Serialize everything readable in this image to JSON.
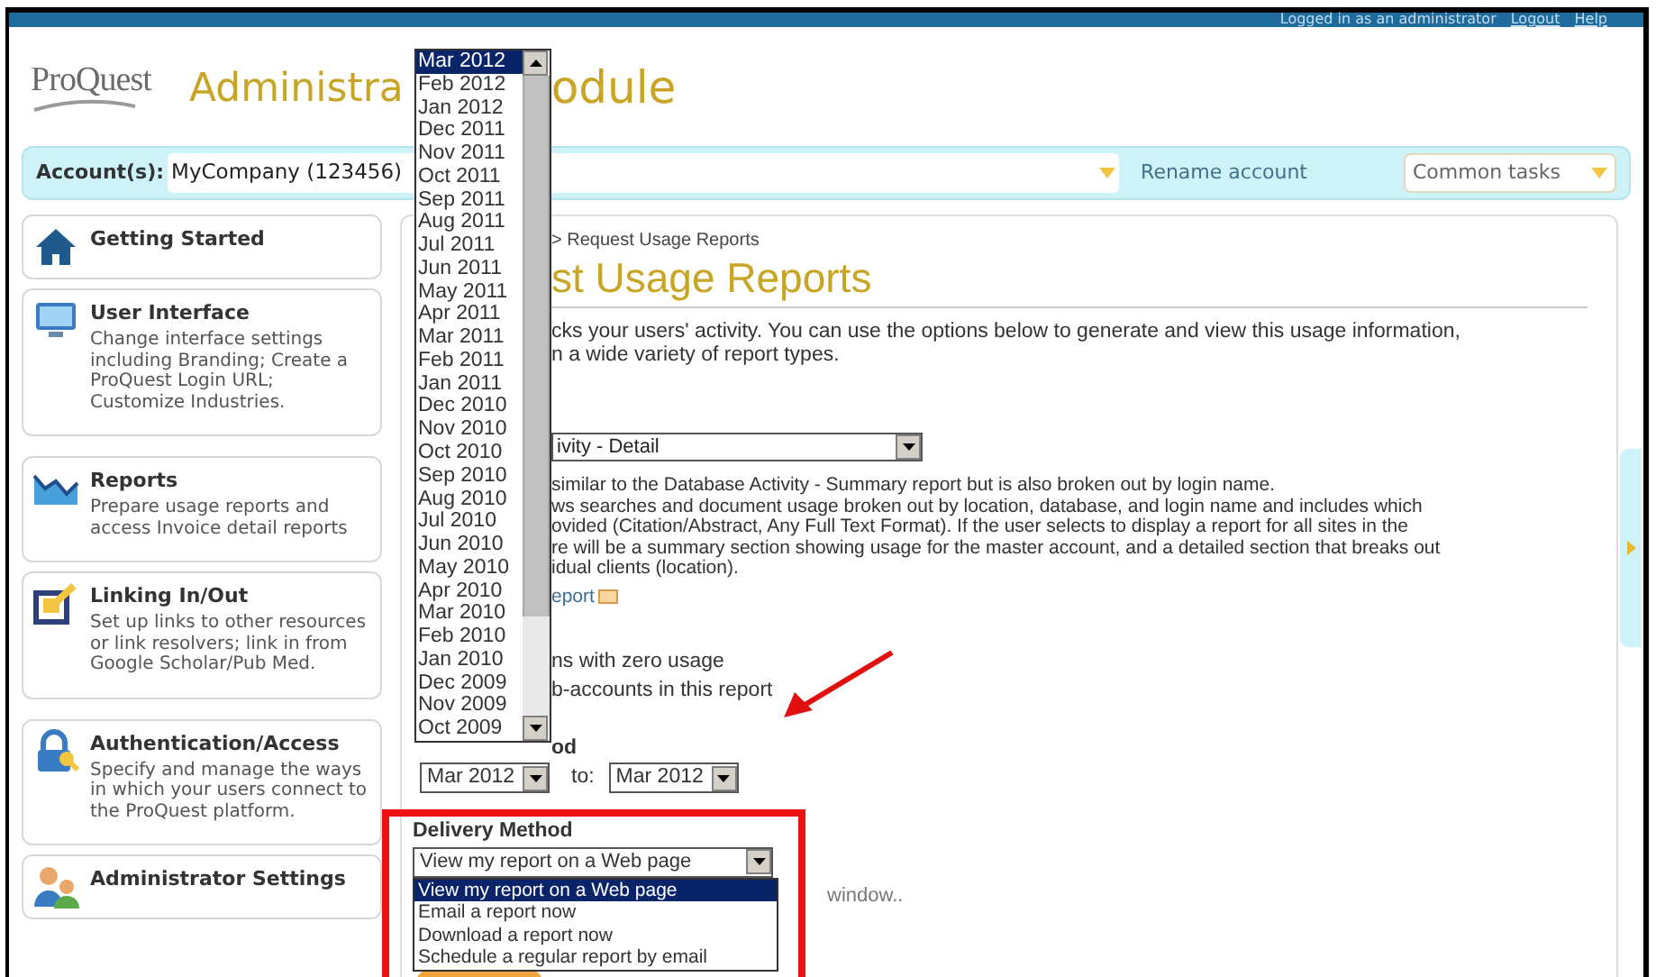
{
  "top_bar": {
    "status": "Logged in as an administrator",
    "links": [
      "Logout",
      "Help"
    ]
  },
  "header": {
    "logo": "ProQuest",
    "title_parts": [
      "Administra",
      "odule"
    ]
  },
  "account_bar": {
    "label": "Account(s):",
    "value": "MyCompany (123456)",
    "rename_link": "Rename account",
    "common_tasks": "Common tasks"
  },
  "sidebar": {
    "items": [
      {
        "kind": "home",
        "title": "Getting Started"
      },
      {
        "kind": "monitor",
        "title": "User Interface",
        "description": "Change interface settings including Branding; Create a ProQuest Login URL; Customize Industries."
      },
      {
        "kind": "chart",
        "title": "Reports",
        "description": "Prepare usage reports and access Invoice detail reports"
      },
      {
        "kind": "link",
        "title": "Linking In/Out",
        "description": "Set up links to other resources or link resolvers; link in from Google Scholar/Pub Med."
      },
      {
        "kind": "lock",
        "title": "Authentication/Access",
        "description": "Specify and manage the ways in which your users connect to the ProQuest platform."
      },
      {
        "kind": "people",
        "title": "Administrator Settings"
      }
    ]
  },
  "main": {
    "breadcrumb": "> Request Usage Reports",
    "title": "st Usage Reports",
    "intro_lines": [
      "cks your users' activity. You can use the options below to generate and view this usage information,",
      "n a wide variety of report types."
    ],
    "report_type": {
      "value": "ivity - Detail"
    },
    "report_description_lines": [
      "similar to the Database Activity - Summary report but is also broken out by login name.",
      "ws searches and document usage broken out by location, database, and login name and includes which",
      "ovided (Citation/Abstract, Any Full Text Format). If the user selects to display a report for all sites in the",
      "re will be a summary section showing usage for the master account, and a detailed section that breaks out",
      "idual clients (location)."
    ],
    "report_link": "eport",
    "option_lines": [
      "ns with zero usage",
      "b-accounts in this report"
    ],
    "report_period": {
      "label": "od",
      "from": "Mar 2012",
      "to_label": "to:",
      "to": "Mar 2012"
    },
    "delivery": {
      "label": "Delivery Method",
      "value": "View my report on a Web page",
      "trailing_text": "window..",
      "options": [
        {
          "label": "View my report on a Web page",
          "selected": true
        },
        {
          "label": "Email a report now",
          "selected": false
        },
        {
          "label": "Download a report now",
          "selected": false
        },
        {
          "label": "Schedule a regular report by email",
          "selected": false
        }
      ]
    }
  },
  "month_list": {
    "items": [
      {
        "label": "Mar 2012",
        "selected": true
      },
      {
        "label": "Feb 2012",
        "selected": false
      },
      {
        "label": "Jan 2012",
        "selected": false
      },
      {
        "label": "Dec 2011",
        "selected": false
      },
      {
        "label": "Nov 2011",
        "selected": false
      },
      {
        "label": "Oct 2011",
        "selected": false
      },
      {
        "label": "Sep 2011",
        "selected": false
      },
      {
        "label": "Aug 2011",
        "selected": false
      },
      {
        "label": "Jul 2011",
        "selected": false
      },
      {
        "label": "Jun 2011",
        "selected": false
      },
      {
        "label": "May 2011",
        "selected": false
      },
      {
        "label": "Apr 2011",
        "selected": false
      },
      {
        "label": "Mar 2011",
        "selected": false
      },
      {
        "label": "Feb 2011",
        "selected": false
      },
      {
        "label": "Jan 2011",
        "selected": false
      },
      {
        "label": "Dec 2010",
        "selected": false
      },
      {
        "label": "Nov 2010",
        "selected": false
      },
      {
        "label": "Oct 2010",
        "selected": false
      },
      {
        "label": "Sep 2010",
        "selected": false
      },
      {
        "label": "Aug 2010",
        "selected": false
      },
      {
        "label": "Jul 2010",
        "selected": false
      },
      {
        "label": "Jun 2010",
        "selected": false
      },
      {
        "label": "May 2010",
        "selected": false
      },
      {
        "label": "Apr 2010",
        "selected": false
      },
      {
        "label": "Mar 2010",
        "selected": false
      },
      {
        "label": "Feb 2010",
        "selected": false
      },
      {
        "label": "Jan 2010",
        "selected": false
      },
      {
        "label": "Dec 2009",
        "selected": false
      },
      {
        "label": "Nov 2009",
        "selected": false
      },
      {
        "label": "Oct 2009",
        "selected": false
      }
    ]
  }
}
